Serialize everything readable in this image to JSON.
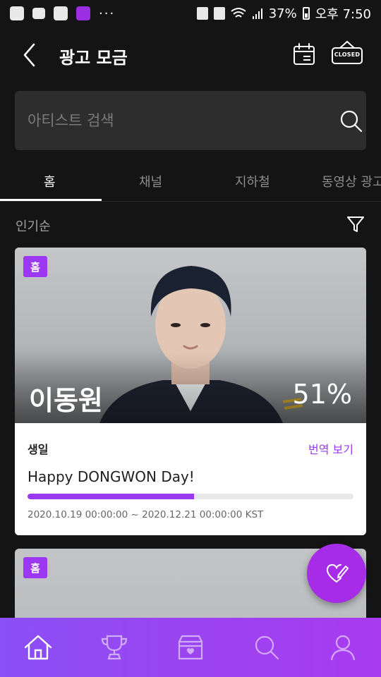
{
  "status_bar": {
    "battery": "37%",
    "time": "오후 7:50",
    "more": "···"
  },
  "header": {
    "title": "광고 모금",
    "closed_label": "CLOSED"
  },
  "search": {
    "placeholder": "아티스트 검색"
  },
  "tabs": [
    {
      "label": "홈",
      "active": true
    },
    {
      "label": "채널",
      "active": false
    },
    {
      "label": "지하철",
      "active": false
    },
    {
      "label": "동영상 광고",
      "active": false
    }
  ],
  "sort": {
    "label": "인기순"
  },
  "cards": [
    {
      "badge": "홈",
      "artist": "이동원",
      "percent_label": "51%",
      "progress": 0.51,
      "category": "생일",
      "translate_label": "번역 보기",
      "ad_title": "Happy DONGWON Day!",
      "period": "2020.10.19 00:00:00 ~ 2020.12.21 00:00:00 KST"
    },
    {
      "badge": "홈"
    }
  ],
  "colors": {
    "accent": "#9c37f2",
    "background": "#141414",
    "search_bg": "#2d2d2d"
  },
  "bottom_nav": [
    {
      "icon": "home-icon",
      "active": true
    },
    {
      "icon": "trophy-icon",
      "active": false
    },
    {
      "icon": "box-heart-icon",
      "active": false
    },
    {
      "icon": "search-icon",
      "active": false
    },
    {
      "icon": "profile-icon",
      "active": false
    }
  ]
}
